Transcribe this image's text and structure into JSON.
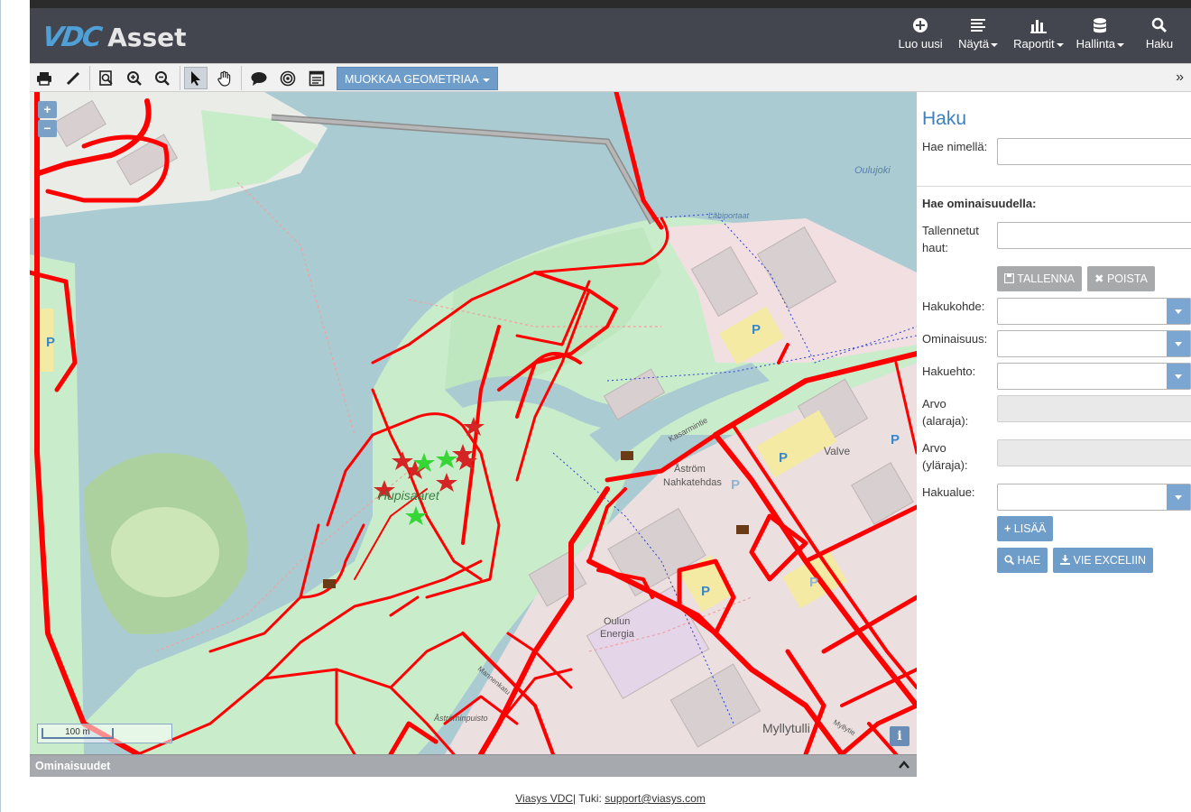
{
  "app": {
    "logo_vdc": "VDC",
    "logo_asset": "Asset"
  },
  "nav": [
    {
      "label": "Luo uusi",
      "icon": "plus-circle-icon",
      "caret": false
    },
    {
      "label": "Näytä",
      "icon": "list-icon",
      "caret": true
    },
    {
      "label": "Raportit",
      "icon": "bar-chart-icon",
      "caret": true
    },
    {
      "label": "Hallinta",
      "icon": "database-icon",
      "caret": true
    },
    {
      "label": "Haku",
      "icon": "search-icon",
      "caret": false
    }
  ],
  "toolbar": {
    "tools": [
      "print-icon",
      "pencil-icon",
      "zoom-extent-icon",
      "zoom-in-icon",
      "zoom-out-icon",
      "pointer-icon",
      "pan-hand-icon",
      "comment-icon",
      "target-icon",
      "list-window-icon"
    ],
    "active_tool": "pointer-icon",
    "edit_geometry_label": "MUOKKAA GEOMETRIAA"
  },
  "map": {
    "zoom_in": "+",
    "zoom_out": "−",
    "scale_label": "100 m",
    "info_label": "i",
    "place_labels": [
      "Oulujoki",
      "Lähiportaat",
      "Hupisaaret",
      "Kasarmintie",
      "Valve",
      "Åström Nahkatehdas",
      "Oulun Energia",
      "Myllytulli",
      "Åströminpuisto",
      "Mannenkatu",
      "Myllytie"
    ]
  },
  "properties_bar": {
    "title": "Ominaisuudet"
  },
  "panel": {
    "title": "Haku",
    "search_by_name_label": "Hae nimellä:",
    "search_by_property_label": "Hae ominaisuudella:",
    "saved_searches_label": "Tallennetut haut:",
    "save_label": "TALLENNA",
    "delete_label": "POISTA",
    "target_label": "Hakukohde:",
    "property_label": "Ominaisuus:",
    "condition_label": "Hakuehto:",
    "value_lower_label": "Arvo (alaraja):",
    "value_upper_label": "Arvo (yläraja):",
    "area_label": "Hakualue:",
    "add_label": "LISÄÄ",
    "search_label": "HAE",
    "export_label": "VIE EXCELIIN"
  },
  "footer": {
    "company": "Viasys VDC",
    "support_prefix": "| Tuki:",
    "email": "support@viasys.com"
  },
  "colors": {
    "header": "#43454f",
    "accent": "#6f9dc9",
    "title": "#3e7fbf",
    "route": "#ff0000"
  }
}
